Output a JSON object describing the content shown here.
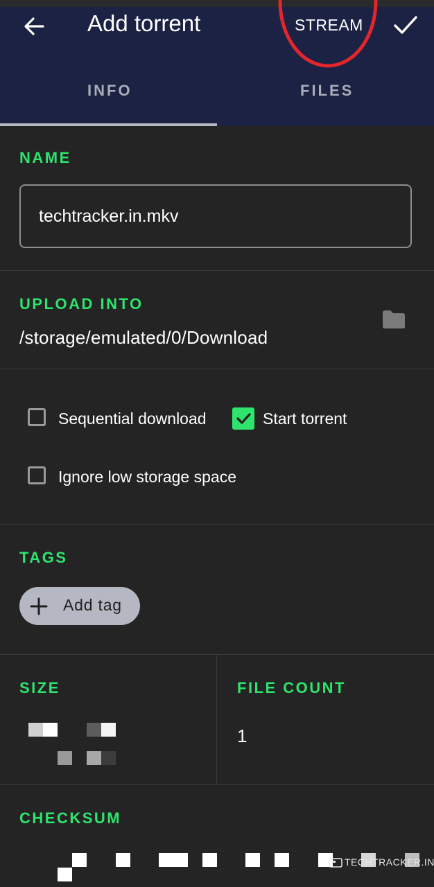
{
  "appbar": {
    "title": "Add torrent",
    "stream_label": "STREAM",
    "back_icon": "arrow-left-icon",
    "confirm_icon": "check-icon",
    "annotation_color": "#e3262b"
  },
  "tabs": [
    {
      "label": "INFO",
      "active": true
    },
    {
      "label": "FILES",
      "active": false
    }
  ],
  "name": {
    "label": "NAME",
    "value": "techtracker.in.mkv"
  },
  "upload": {
    "label": "UPLOAD INTO",
    "path": "/storage/emulated/0/Download",
    "folder_icon": "folder-icon"
  },
  "options": {
    "sequential": {
      "label": "Sequential download",
      "checked": false
    },
    "start": {
      "label": "Start torrent",
      "checked": true
    },
    "ignore_storage": {
      "label": "Ignore low storage space",
      "checked": false
    }
  },
  "tags": {
    "label": "TAGS",
    "add_label": "Add tag"
  },
  "size": {
    "label": "SIZE"
  },
  "file_count": {
    "label": "FILE COUNT",
    "value": "1"
  },
  "checksum": {
    "label": "CHECKSUM"
  },
  "watermark": {
    "text": "TECHTRACKER.IN"
  },
  "colors": {
    "appbar": "#1c2243",
    "background": "#242424",
    "accent": "#2ee46d",
    "tab_inactive": "#a9adb8",
    "chip": "#b5b8c2"
  }
}
